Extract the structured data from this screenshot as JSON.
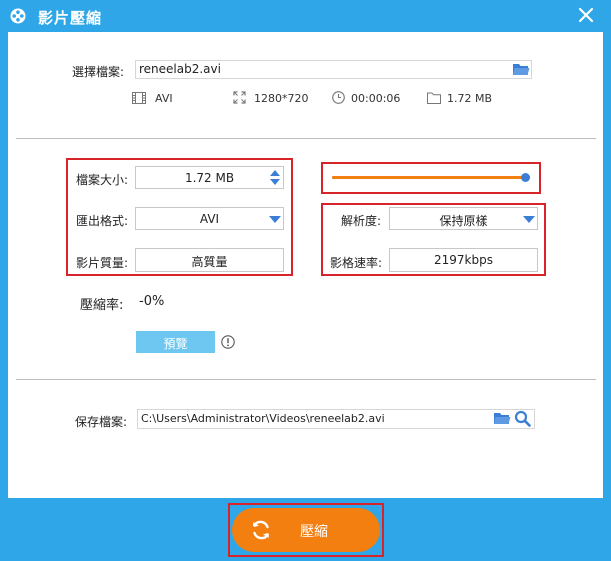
{
  "window": {
    "title": "影片壓縮"
  },
  "file": {
    "label": "選擇檔案:",
    "value": "reneelab2.avi",
    "format": "AVI",
    "resolution": "1280*720",
    "duration": "00:00:06",
    "size": "1.72 MB"
  },
  "settings": {
    "filesize_label": "檔案大小:",
    "filesize_value": "1.72 MB",
    "format_label": "匯出格式:",
    "format_value": "AVI",
    "quality_label": "影片質量:",
    "quality_value": "高質量",
    "resolution_label": "解析度:",
    "resolution_value": "保持原樣",
    "bitrate_label": "影格速率:",
    "bitrate_value": "2197kbps",
    "slider_level": 1.0
  },
  "ratio": {
    "label": "壓縮率:",
    "value": "-0%"
  },
  "preview": {
    "label": "預覽"
  },
  "save": {
    "label": "保存檔案:",
    "path": "C:\\Users\\Administrator\\Videos\\reneelab2.avi"
  },
  "compress": {
    "label": "壓縮"
  },
  "colors": {
    "accent": "#2fa6e8",
    "orange": "#f27f10",
    "highlight": "#d9232b",
    "icon_blue": "#3a7fd5"
  }
}
